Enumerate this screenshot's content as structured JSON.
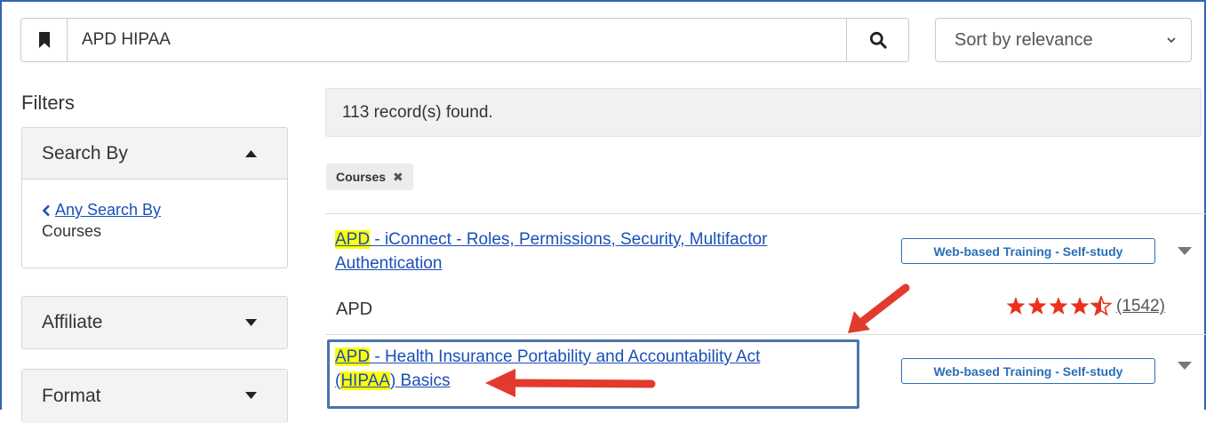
{
  "search": {
    "value": "APD HIPAA"
  },
  "sort": {
    "selected": "Sort by relevance"
  },
  "filters": {
    "title": "Filters",
    "panels": [
      {
        "label": "Search By",
        "expanded": true,
        "link": "Any Search By",
        "value": "Courses"
      },
      {
        "label": "Affiliate",
        "expanded": false
      },
      {
        "label": "Format",
        "expanded": false
      }
    ]
  },
  "results": {
    "summary": "113 record(s) found.",
    "active_filter": "Courses",
    "items": [
      {
        "title_highlight": "APD",
        "title_line1": " - iConnect - Roles, Permissions, Security, Multifactor",
        "title_line2": "Authentication",
        "format": "Web-based Training - Self-study",
        "provider": "APD",
        "rating": 4.5,
        "rating_count": "(1542)"
      },
      {
        "title_highlight": "APD",
        "title_line1": " - Health Insurance Portability and Accountability Act",
        "title_line2_open": "(",
        "title_line2_highlight": "HIPAA",
        "title_line2_rest": ") Basics",
        "format": "Web-based Training - Self-study"
      }
    ]
  },
  "icons": {
    "bookmark": "bookmark-icon",
    "search": "search-icon",
    "sort_caret": "chevron-down-icon",
    "panel_collapse": "caret-up-icon",
    "panel_expand": "caret-down-icon",
    "back": "chevron-left-icon",
    "remove_filter": "close-icon",
    "result_menu": "caret-down-icon",
    "star": "star-icon"
  },
  "colors": {
    "link": "#1a4fb8",
    "badge": "#2a6eb8",
    "highlight": "#ffff00",
    "star": "#e8321c",
    "annotation_arrow": "#e23a2c",
    "annotation_box": "#4c72ad",
    "frame": "#2f67b1"
  }
}
